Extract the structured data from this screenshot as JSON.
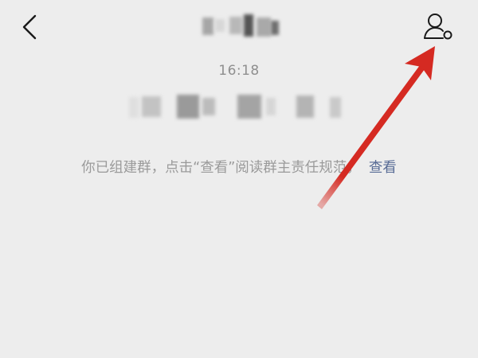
{
  "header": {
    "back_icon": "chevron-left-icon",
    "title_obscured": true,
    "profile_icon": "user-settings-icon"
  },
  "chat": {
    "timestamp": "16:18",
    "system_notice": "你已组建群，点击“查看”阅读群主责任规范，",
    "notice_link": "查看"
  },
  "annotation": {
    "type": "red-arrow",
    "points_to": "profile-button",
    "color": "#d52a22"
  },
  "colors": {
    "background": "#ededed",
    "icon": "#1a1a1a",
    "muted_text": "#9a9a9a",
    "link": "#576b95"
  }
}
